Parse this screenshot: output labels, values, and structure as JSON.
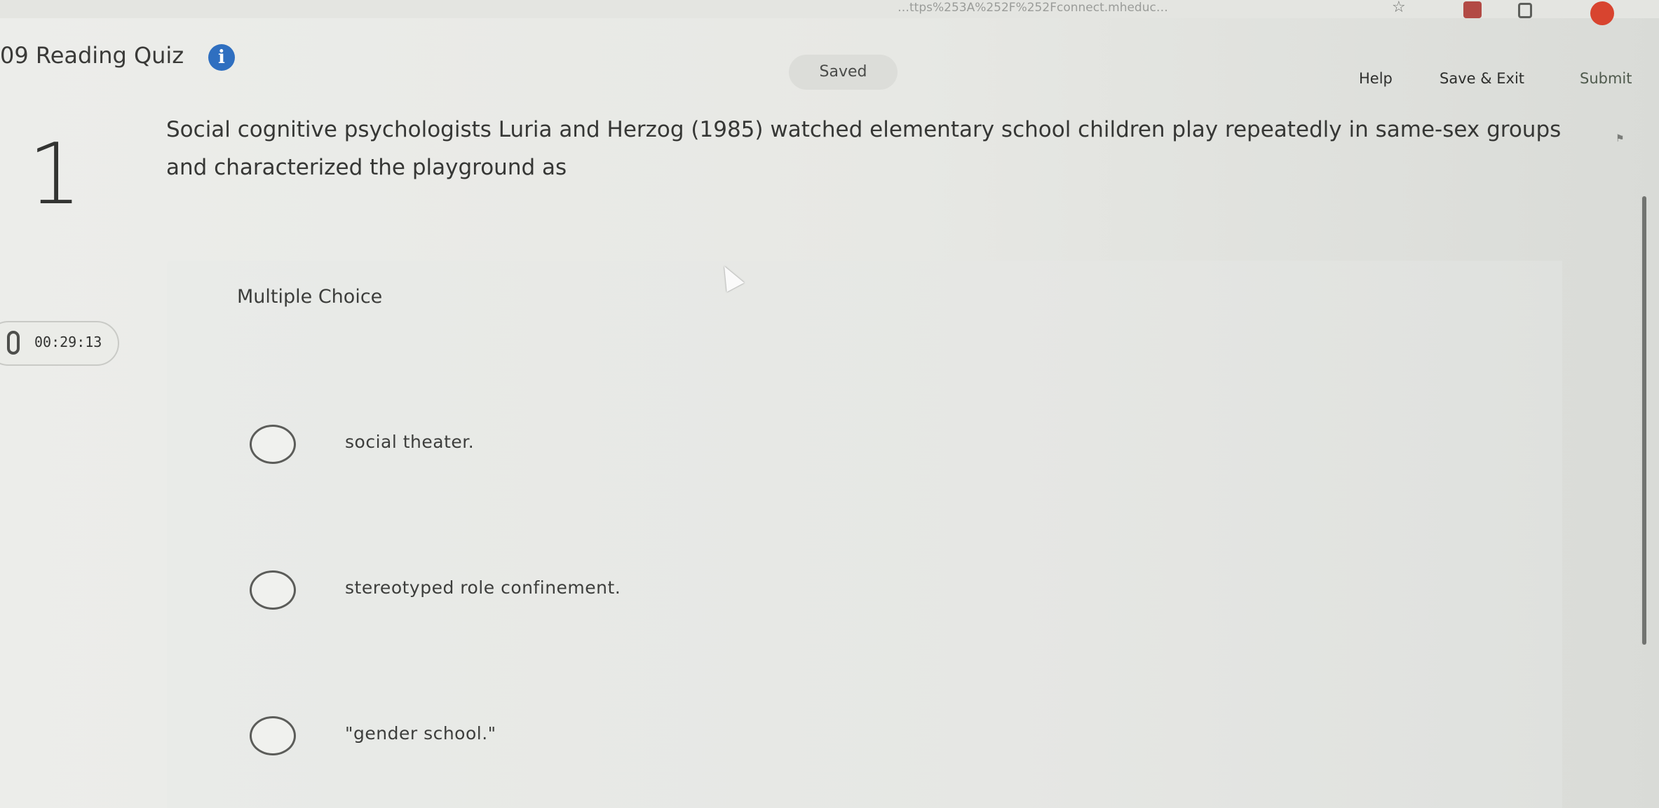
{
  "browser": {
    "url": "…ttps%253A%252F%252Fconnect.mheduc…",
    "star_icon": "star-icon"
  },
  "header": {
    "quiz_title": "09 Reading Quiz",
    "info_icon": "info-icon",
    "info_glyph": "i",
    "status": "Saved",
    "help_label": "Help",
    "save_exit_label": "Save & Exit",
    "submit_label": "Submit"
  },
  "question": {
    "number": "1",
    "text": "Social cognitive psychologists Luria and Herzog (1985) watched elementary school children play repeatedly in same-sex groups and characterized the playground as",
    "type_label": "Multiple Choice"
  },
  "timer": {
    "icon": "hourglass-icon",
    "value": "00:29:13"
  },
  "options": [
    {
      "label": "social theater.",
      "selected": false
    },
    {
      "label": "stereotyped role confinement.",
      "selected": false
    },
    {
      "label": "\"gender school.\"",
      "selected": false
    }
  ],
  "colors": {
    "info_blue": "#2f6fc0",
    "background": "#e9eae5"
  }
}
